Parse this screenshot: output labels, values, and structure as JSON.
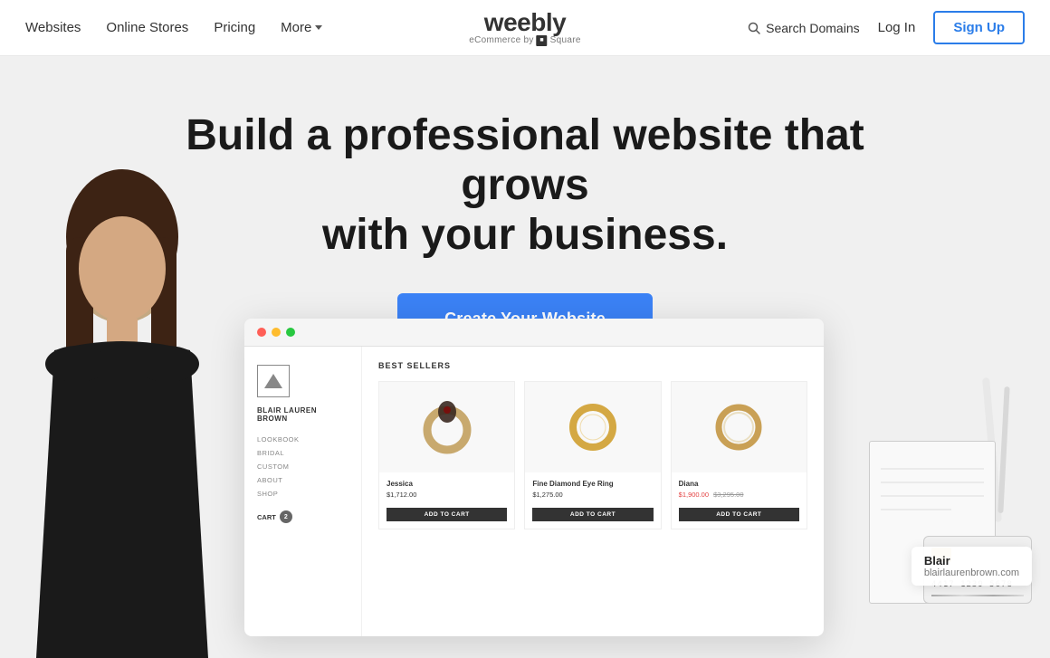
{
  "header": {
    "nav_websites": "Websites",
    "nav_online_stores": "Online Stores",
    "nav_pricing": "Pricing",
    "nav_more": "More",
    "logo_name": "weebly",
    "logo_sub": "eCommerce by",
    "logo_brand": "Square",
    "search_label": "Search Domains",
    "login_label": "Log In",
    "signup_label": "Sign Up"
  },
  "hero": {
    "title_line1": "Build a professional website that grows",
    "title_line2": "with your business.",
    "cta_label": "Create Your Website"
  },
  "store": {
    "browser_dots": [
      "red",
      "yellow",
      "green"
    ],
    "store_name": "BLAIR LAUREN BROWN",
    "nav_items": [
      "LOOKBOOK",
      "BRIDAL",
      "CUSTOM",
      "ABOUT",
      "SHOP"
    ],
    "cart_label": "CART",
    "cart_count": "2",
    "best_sellers_title": "BEST SELLERS",
    "products": [
      {
        "name": "Jessica",
        "price": "$1,712.00",
        "is_sale": false,
        "btn_label": "ADD TO CART"
      },
      {
        "name": "Fine Diamond Eye Ring",
        "price": "$1,275.00",
        "is_sale": false,
        "btn_label": "ADD TO CART"
      },
      {
        "name": "Diana",
        "sale_price": "$1,900.00",
        "original_price": "$3,295.00",
        "is_sale": true,
        "btn_label": "ADD TO CART"
      }
    ]
  },
  "blair_card": {
    "name": "Blair",
    "url": "blairlaurenbrown.com"
  },
  "colors": {
    "cta_bg": "#3b82f6",
    "signup_border": "#2b7de9",
    "signup_text": "#2b7de9",
    "sale_price": "#e44444"
  }
}
